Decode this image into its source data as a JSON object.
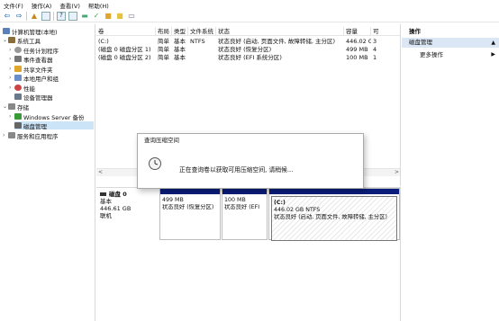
{
  "menu": [
    "文件(F)",
    "操作(A)",
    "查看(V)",
    "帮助(H)"
  ],
  "tree": {
    "root": "计算机管理(本地)",
    "system_tools": "系统工具",
    "task_scheduler": "任务计划程序",
    "event_viewer": "事件查看器",
    "shared_folders": "共享文件夹",
    "local_users": "本地用户和组",
    "performance": "性能",
    "device_manager": "设备管理器",
    "storage": "存储",
    "windows_backup": "Windows Server 备份",
    "disk_management": "磁盘管理",
    "services_apps": "服务和应用程序"
  },
  "volume_list": {
    "headers": [
      "卷",
      "布局",
      "类型",
      "文件系统",
      "状态",
      "容量",
      "可"
    ],
    "rows": [
      [
        "(C:)",
        "简单",
        "基本",
        "NTFS",
        "状态良好 (启动, 页面文件, 故障转储, 主分区)",
        "446.02 GB",
        "3"
      ],
      [
        "(磁盘 0 磁盘分区 1)",
        "简单",
        "基本",
        "",
        "状态良好 (恢复分区)",
        "499 MB",
        "4"
      ],
      [
        "(磁盘 0 磁盘分区 2)",
        "简单",
        "基本",
        "",
        "状态良好 (EFI 系统分区)",
        "100 MB",
        "1"
      ]
    ],
    "scroll_left": "<",
    "scroll_right": ">"
  },
  "disk": {
    "name": "磁盘 0",
    "type": "基本",
    "size": "446.61 GB",
    "status": "联机",
    "partitions": [
      {
        "label": "",
        "size": "499 MB",
        "status": "状态良好 (恢复分区)"
      },
      {
        "label": "",
        "size": "100 MB",
        "status": "状态良好 (EFI"
      },
      {
        "label": "(C:)",
        "size": "446.02 GB NTFS",
        "status": "状态良好 (启动, 页面文件, 故障转储, 主分区)"
      }
    ]
  },
  "actions": {
    "header": "操作",
    "section": "磁盘管理",
    "more": "更多操作",
    "up_caret": "▲",
    "right_caret": "▶"
  },
  "dialog": {
    "title": "查询压缩空间",
    "message": "正在查询卷以获取可用压缩空间, 请稍候..."
  }
}
